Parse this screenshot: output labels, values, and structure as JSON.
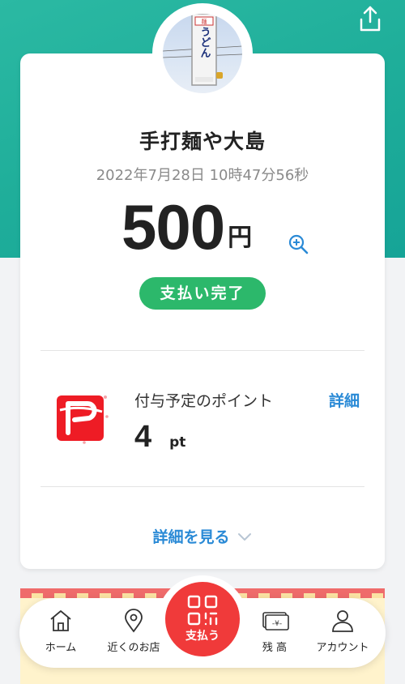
{
  "header": {
    "share_icon": "share-icon"
  },
  "merchant": {
    "name": "手打麺や大島",
    "sign_text": "うどん"
  },
  "transaction": {
    "datetime": "2022年7月28日 10時47分56秒",
    "amount": "500",
    "currency": "円",
    "status": "支払い完了"
  },
  "points": {
    "label": "付与予定のポイント",
    "detail_link": "詳細",
    "value": "4",
    "unit": "pt"
  },
  "details_link": "詳細を見る",
  "tabbar": {
    "home": "ホーム",
    "nearby": "近くのお店",
    "pay": "支払う",
    "balance": "残 高",
    "account": "アカウント"
  },
  "colors": {
    "header_teal": "#1fae9a",
    "status_green": "#2cb86b",
    "link_blue": "#2a8ad6",
    "pay_red": "#f03a3a"
  }
}
